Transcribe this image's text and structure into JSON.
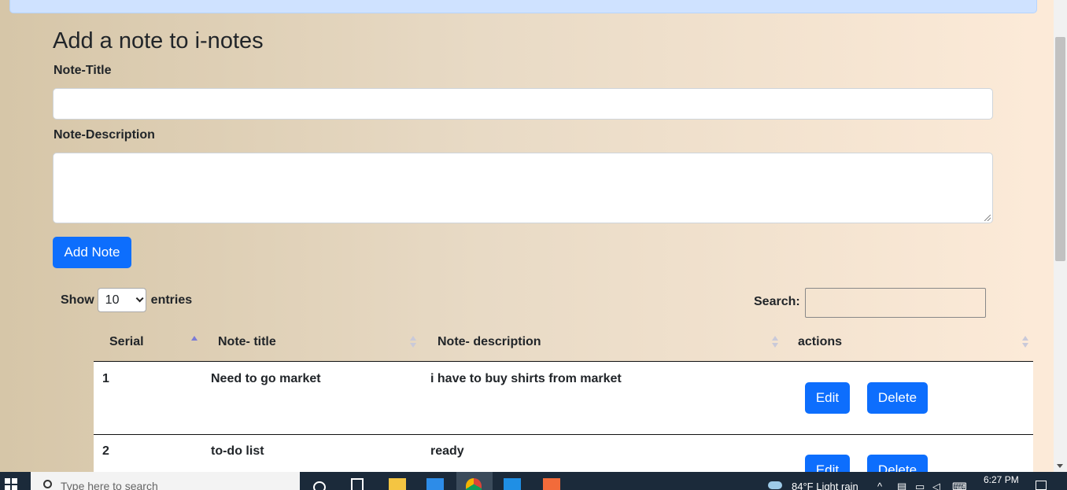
{
  "form": {
    "title": "Add a note to i-notes",
    "title_label": "Note-Title",
    "title_value": "",
    "description_label": "Note-Description",
    "description_value": "",
    "submit_label": "Add Note"
  },
  "table_controls": {
    "show_label": "Show",
    "entries_value": "10",
    "entries_label": "entries",
    "search_label": "Search:",
    "search_value": ""
  },
  "table": {
    "columns": [
      "Serial",
      "Note- title",
      "Note- description",
      "actions"
    ],
    "rows": [
      {
        "serial": "1",
        "title": "Need to go market",
        "description": "i have to buy shirts from market",
        "edit": "Edit",
        "delete": "Delete"
      },
      {
        "serial": "2",
        "title": "to-do list",
        "description": "ready",
        "edit": "Edit",
        "delete": "Delete"
      }
    ]
  },
  "taskbar": {
    "search_placeholder": "Type here to search",
    "weather": "84°F  Light rain",
    "time": "6:27 PM"
  },
  "colors": {
    "primary": "#0d6efd",
    "taskbar": "#1b2a3a",
    "alert": "#cfe2ff"
  }
}
